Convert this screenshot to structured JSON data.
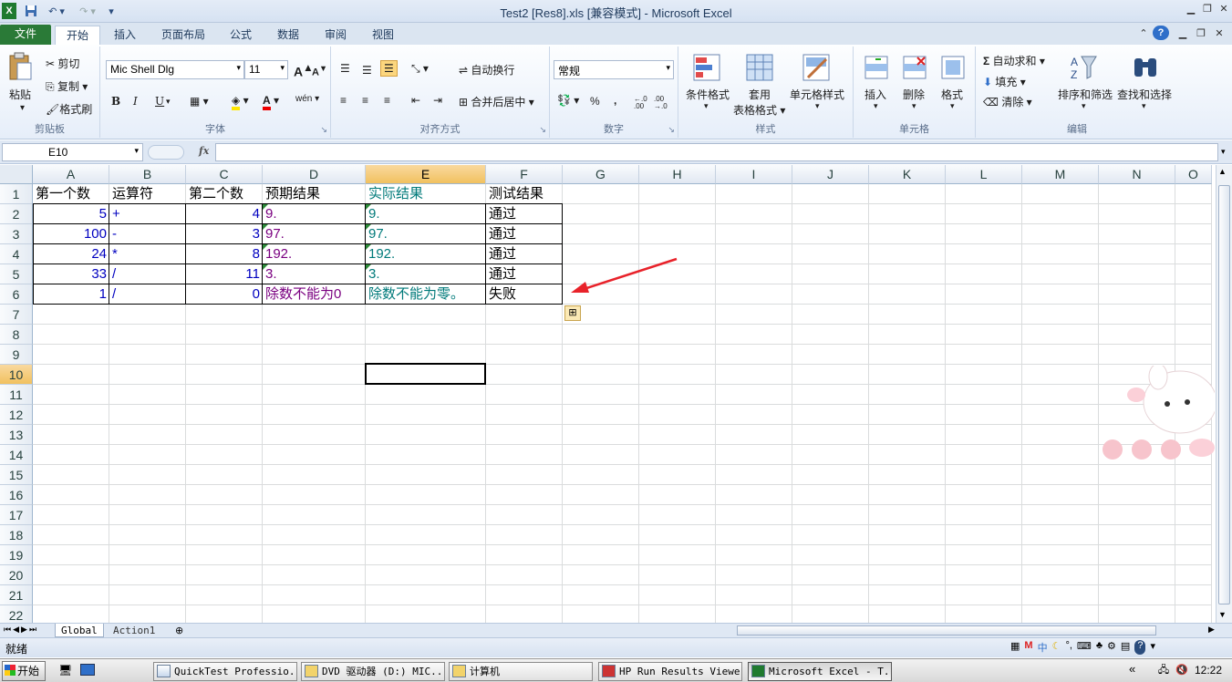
{
  "window": {
    "title": "Test2 [Res8].xls  [兼容模式] - Microsoft Excel"
  },
  "ribbon_tabs": [
    "文件",
    "开始",
    "插入",
    "页面布局",
    "公式",
    "数据",
    "审阅",
    "视图"
  ],
  "clipboard": {
    "paste": "粘贴",
    "cut": "剪切",
    "copy": "复制",
    "format_painter": "格式刷",
    "label": "剪贴板"
  },
  "font": {
    "name": "Mic Shell Dlg",
    "size": "11",
    "bold": "B",
    "italic": "I",
    "underline": "U",
    "label": "字体",
    "grow": "A",
    "shrink": "A",
    "phonetic": "wén"
  },
  "alignment": {
    "wrap": "自动换行",
    "merge": "合并后居中",
    "label": "对齐方式"
  },
  "number": {
    "format": "常规",
    "label": "数字",
    "percent": "%",
    "comma": ",",
    "dec_up": "←.0 .00",
    "dec_down": ".00 →.0"
  },
  "styles": {
    "cond": "条件格式",
    "table_1": "套用",
    "table_2": "表格格式",
    "cell": "单元格样式",
    "label": "样式"
  },
  "cells_group": {
    "insert": "插入",
    "delete": "删除",
    "format": "格式",
    "label": "单元格"
  },
  "editing": {
    "autosum": "自动求和",
    "fill": "填充",
    "clear": "清除",
    "sort": "排序和筛选",
    "find": "查找和选择",
    "label": "编辑"
  },
  "formula_bar": {
    "cell_ref": "E10",
    "fx": "fx",
    "value": ""
  },
  "columns": [
    "A",
    "B",
    "C",
    "D",
    "E",
    "F",
    "G",
    "H",
    "I",
    "J",
    "K",
    "L",
    "M",
    "N",
    "O"
  ],
  "rows": [
    "1",
    "2",
    "3",
    "4",
    "5",
    "6",
    "7",
    "8",
    "9",
    "10",
    "11",
    "12",
    "13",
    "14",
    "15",
    "16",
    "17",
    "18",
    "19",
    "20",
    "21",
    "22"
  ],
  "table": {
    "header": [
      "第一个数",
      "运算符",
      "第二个数",
      "预期结果",
      "实际结果",
      "测试结果"
    ],
    "data": [
      [
        "5",
        "+",
        "4",
        "9.",
        "9.",
        "通过"
      ],
      [
        "100",
        "-",
        "3",
        "97.",
        "97.",
        "通过"
      ],
      [
        "24",
        "*",
        "8",
        "192.",
        "192.",
        "通过"
      ],
      [
        "33",
        "/",
        "11",
        "3.",
        "3.",
        "通过"
      ],
      [
        "1",
        "/",
        "0",
        "除数不能为0",
        "除数不能为零。",
        "失败"
      ]
    ]
  },
  "sheets": [
    "Global",
    "Action1"
  ],
  "status": {
    "ready": "就绪"
  },
  "taskbar": {
    "start": "开始",
    "buttons": [
      "QuickTest Professio...",
      "DVD 驱动器 (D:) MIC...",
      "计算机",
      "HP Run Results Viewer",
      "Microsoft Excel - T..."
    ],
    "clock": "12:22"
  },
  "colors": {
    "number_text": "#0000c0",
    "expected_text": "#7a0080",
    "actual_text": "#007a7a",
    "arrow": "#e8222a",
    "file_tab": "#2a7a37"
  }
}
